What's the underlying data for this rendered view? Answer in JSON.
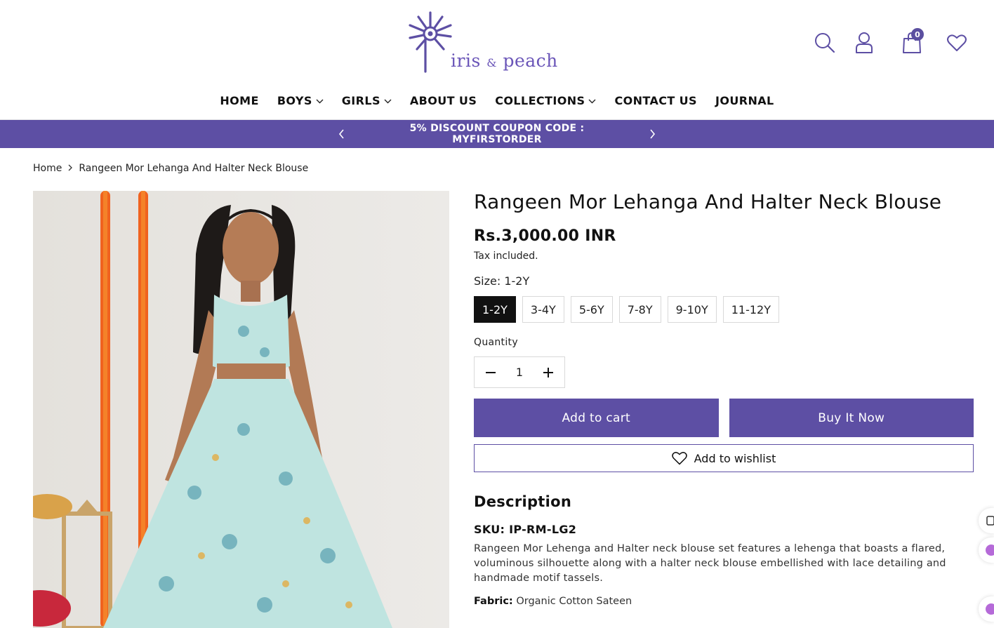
{
  "brand": {
    "logo_word1": "iris",
    "logo_amp": "&",
    "logo_word2": "peach",
    "color": "#5d4fa4"
  },
  "header": {
    "icons": [
      "search-icon",
      "account-icon",
      "cart-icon",
      "wishlist-icon"
    ],
    "cart_count": "0"
  },
  "nav": {
    "items": [
      {
        "label": "HOME",
        "dropdown": false
      },
      {
        "label": "BOYS",
        "dropdown": true
      },
      {
        "label": "GIRLS",
        "dropdown": true
      },
      {
        "label": "ABOUT US",
        "dropdown": false
      },
      {
        "label": "COLLECTIONS",
        "dropdown": true
      },
      {
        "label": "CONTACT US",
        "dropdown": false
      },
      {
        "label": "JOURNAL",
        "dropdown": false
      }
    ]
  },
  "announcement": {
    "text": "5% DISCOUNT COUPON CODE : MYFIRSTORDER"
  },
  "breadcrumb": {
    "home": "Home",
    "current": "Rangeen Mor Lehanga And Halter Neck Blouse"
  },
  "product": {
    "title": "Rangeen Mor Lehanga And Halter Neck Blouse",
    "price": "Rs.3,000.00 INR",
    "tax_note": "Tax included.",
    "size_label": "Size: 1-2Y",
    "sizes": [
      "1-2Y",
      "3-4Y",
      "5-6Y",
      "7-8Y",
      "9-10Y",
      "11-12Y"
    ],
    "selected_size": "1-2Y",
    "quantity_label": "Quantity",
    "quantity_value": "1",
    "add_to_cart": "Add to cart",
    "buy_now": "Buy It Now",
    "add_to_wishlist": "Add to wishlist",
    "description_heading": "Description",
    "sku": "SKU: IP-RM-LG2",
    "description": "Rangeen Mor Lehenga and Halter neck blouse set features a lehenga that boasts a flared, voluminous silhouette along with a halter neck blouse embellished with lace detailing and handmade motif tassels.",
    "fabric_label": "Fabric:",
    "fabric_value": "Organic Cotton Sateen"
  }
}
